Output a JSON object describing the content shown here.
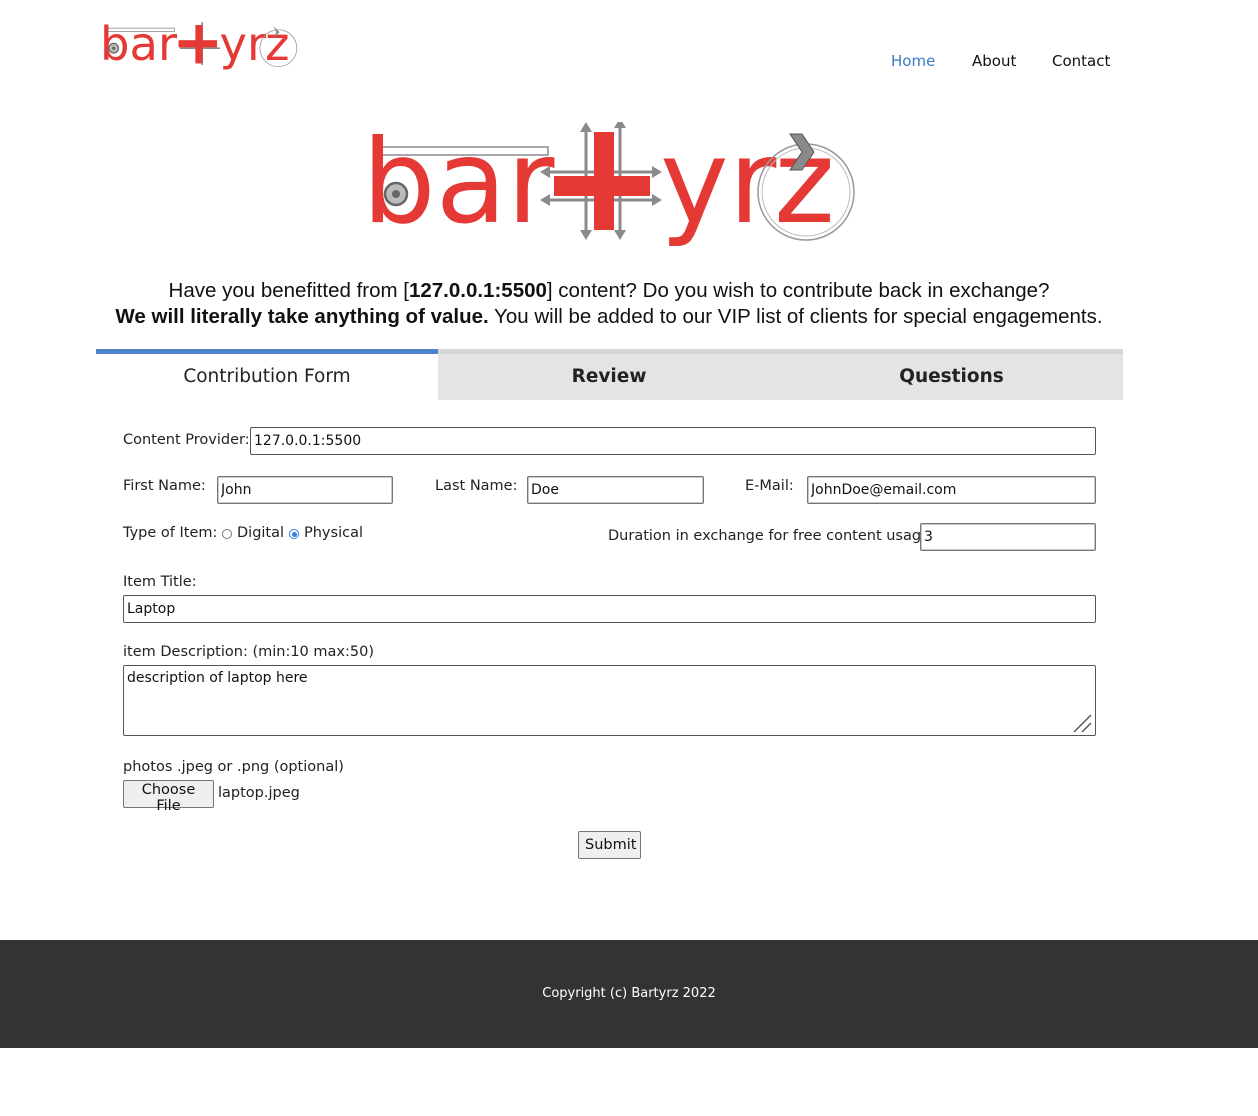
{
  "brand": {
    "logo_text": "bartyrz",
    "colors": {
      "red": "#e53935",
      "gray": "#8a8a8a",
      "accent": "#4d83c8"
    }
  },
  "nav": {
    "items": [
      {
        "label": "Home",
        "active": true
      },
      {
        "label": "About",
        "active": false
      },
      {
        "label": "Contact",
        "active": false
      }
    ]
  },
  "intro": {
    "line1_prefix": "Have you benefitted from [",
    "line1_host": "127.0.0.1:5500",
    "line1_suffix": "] content? Do you wish to contribute back in exchange?",
    "line2_bold": "We will literally take anything of value.",
    "line2_rest": " You will be added to our VIP list of clients for special engagements."
  },
  "tabs": [
    {
      "label": "Contribution Form",
      "active": true
    },
    {
      "label": "Review",
      "active": false
    },
    {
      "label": "Questions",
      "active": false
    }
  ],
  "form": {
    "content_provider": {
      "label": "Content Provider:",
      "value": "127.0.0.1:5500"
    },
    "first_name": {
      "label": "First Name:",
      "value": "John"
    },
    "last_name": {
      "label": "Last Name:",
      "value": "Doe"
    },
    "email": {
      "label": "E-Mail:",
      "value": "JohnDoe@email.com"
    },
    "type_of_item": {
      "label": "Type of Item:",
      "options": [
        {
          "label": "Digital",
          "checked": false
        },
        {
          "label": "Physical",
          "checked": true
        }
      ]
    },
    "duration": {
      "label": "Duration in exchange for free content usage:",
      "value": "3"
    },
    "item_title": {
      "label": "Item Title:",
      "value": "Laptop"
    },
    "item_description": {
      "label": "item Description: (min:10 max:50)",
      "value": "description of laptop here"
    },
    "photos": {
      "label": "photos .jpeg or .png (optional)",
      "button_label": "Choose File",
      "file_name": "laptop.jpeg"
    },
    "submit_label": "Submit"
  },
  "footer": {
    "copyright": "Copyright (c) Bartyrz 2022"
  }
}
